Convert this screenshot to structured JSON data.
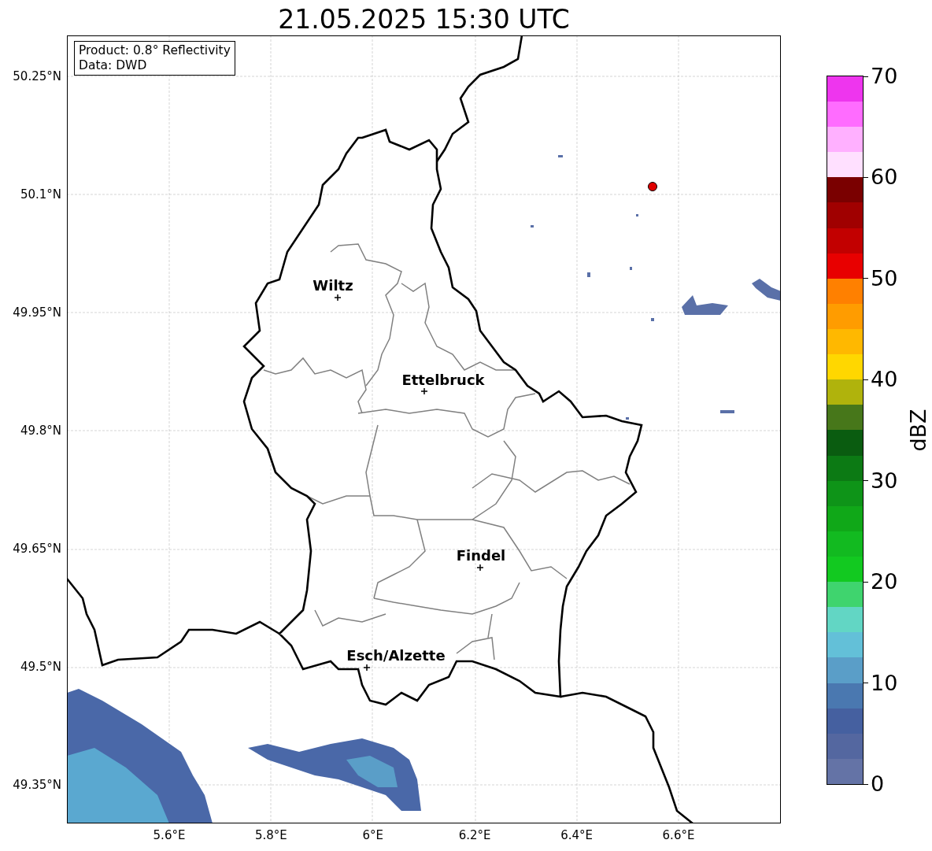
{
  "title": "21.05.2025 15:30 UTC",
  "info_box": {
    "lines": [
      "Product: 0.8° Reflectivity",
      "Data: DWD"
    ]
  },
  "y_ticks": [
    "50.25°N",
    "50.1°N",
    "49.95°N",
    "49.8°N",
    "49.65°N",
    "49.5°N",
    "49.35°N"
  ],
  "x_ticks": [
    "5.6°E",
    "5.8°E",
    "6°E",
    "6.2°E",
    "6.4°E",
    "6.6°E"
  ],
  "cities": [
    {
      "name": "Wiltz"
    },
    {
      "name": "Ettelbruck"
    },
    {
      "name": "Findel"
    },
    {
      "name": "Esch/Alzette"
    }
  ],
  "colorbar": {
    "label": "dBZ",
    "ticks": [
      "70",
      "60",
      "50",
      "40",
      "30",
      "20",
      "10",
      "0"
    ],
    "segments": [
      {
        "color": "#6473a6"
      },
      {
        "color": "#5467a0"
      },
      {
        "color": "#4560a0"
      },
      {
        "color": "#4a78b0"
      },
      {
        "color": "#5a9ec8"
      },
      {
        "color": "#63c0d8"
      },
      {
        "color": "#62d6c4"
      },
      {
        "color": "#3fd46e"
      },
      {
        "color": "#12c920"
      },
      {
        "color": "#12ba20"
      },
      {
        "color": "#10a818"
      },
      {
        "color": "#0e9418"
      },
      {
        "color": "#0c7a14"
      },
      {
        "color": "#0a5c10"
      },
      {
        "color": "#47771a"
      },
      {
        "color": "#b0b30c"
      },
      {
        "color": "#ffd700"
      },
      {
        "color": "#ffb800"
      },
      {
        "color": "#ff9c00"
      },
      {
        "color": "#ff8000"
      },
      {
        "color": "#e80000"
      },
      {
        "color": "#c20000"
      },
      {
        "color": "#a00000"
      },
      {
        "color": "#7a0000"
      },
      {
        "color": "#ffe0ff"
      },
      {
        "color": "#ffb0ff"
      },
      {
        "color": "#ff6cff"
      },
      {
        "color": "#ee35ee"
      }
    ]
  }
}
